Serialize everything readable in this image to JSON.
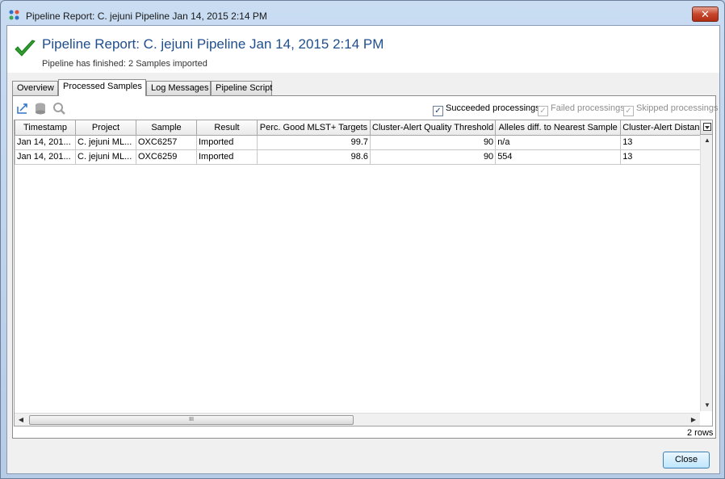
{
  "window": {
    "title": "Pipeline Report: C. jejuni Pipeline Jan 14, 2015 2:14 PM",
    "close_glyph": "✕"
  },
  "header": {
    "title": "Pipeline Report: C. jejuni Pipeline Jan 14, 2015 2:14 PM",
    "subtitle": "Pipeline has finished: 2 Samples imported",
    "status_icon": "checkmark-icon",
    "status_color": "#2e9e2e"
  },
  "tabs": [
    {
      "label": "Overview",
      "active": false
    },
    {
      "label": "Processed Samples",
      "active": true
    },
    {
      "label": "Log Messages",
      "active": false
    },
    {
      "label": "Pipeline Script",
      "active": false
    }
  ],
  "toolbar": {
    "icons": [
      "export-icon",
      "database-icon",
      "search-zoom-icon"
    ]
  },
  "filters": [
    {
      "label": "Succeeded processings",
      "checked": true,
      "enabled": true
    },
    {
      "label": "Failed processings",
      "checked": true,
      "enabled": false
    },
    {
      "label": "Skipped processings",
      "checked": true,
      "enabled": false
    }
  ],
  "table": {
    "columns": [
      "Timestamp",
      "Project",
      "Sample",
      "Result",
      "Perc. Good MLST+ Targets",
      "Cluster-Alert Quality Threshold",
      "Alleles diff. to Nearest Sample",
      "Cluster-Alert Distan"
    ],
    "rows": [
      [
        "Jan 14, 201...",
        "C. jejuni ML...",
        "OXC6257",
        "Imported",
        "99.7",
        "90",
        "n/a",
        "13"
      ],
      [
        "Jan 14, 201...",
        "C. jejuni ML...",
        "OXC6259",
        "Imported",
        "98.6",
        "90",
        "554",
        "13"
      ]
    ],
    "row_count_label": "2 rows",
    "scroll_thumb_grip": "III"
  },
  "footer": {
    "close_label": "Close"
  }
}
